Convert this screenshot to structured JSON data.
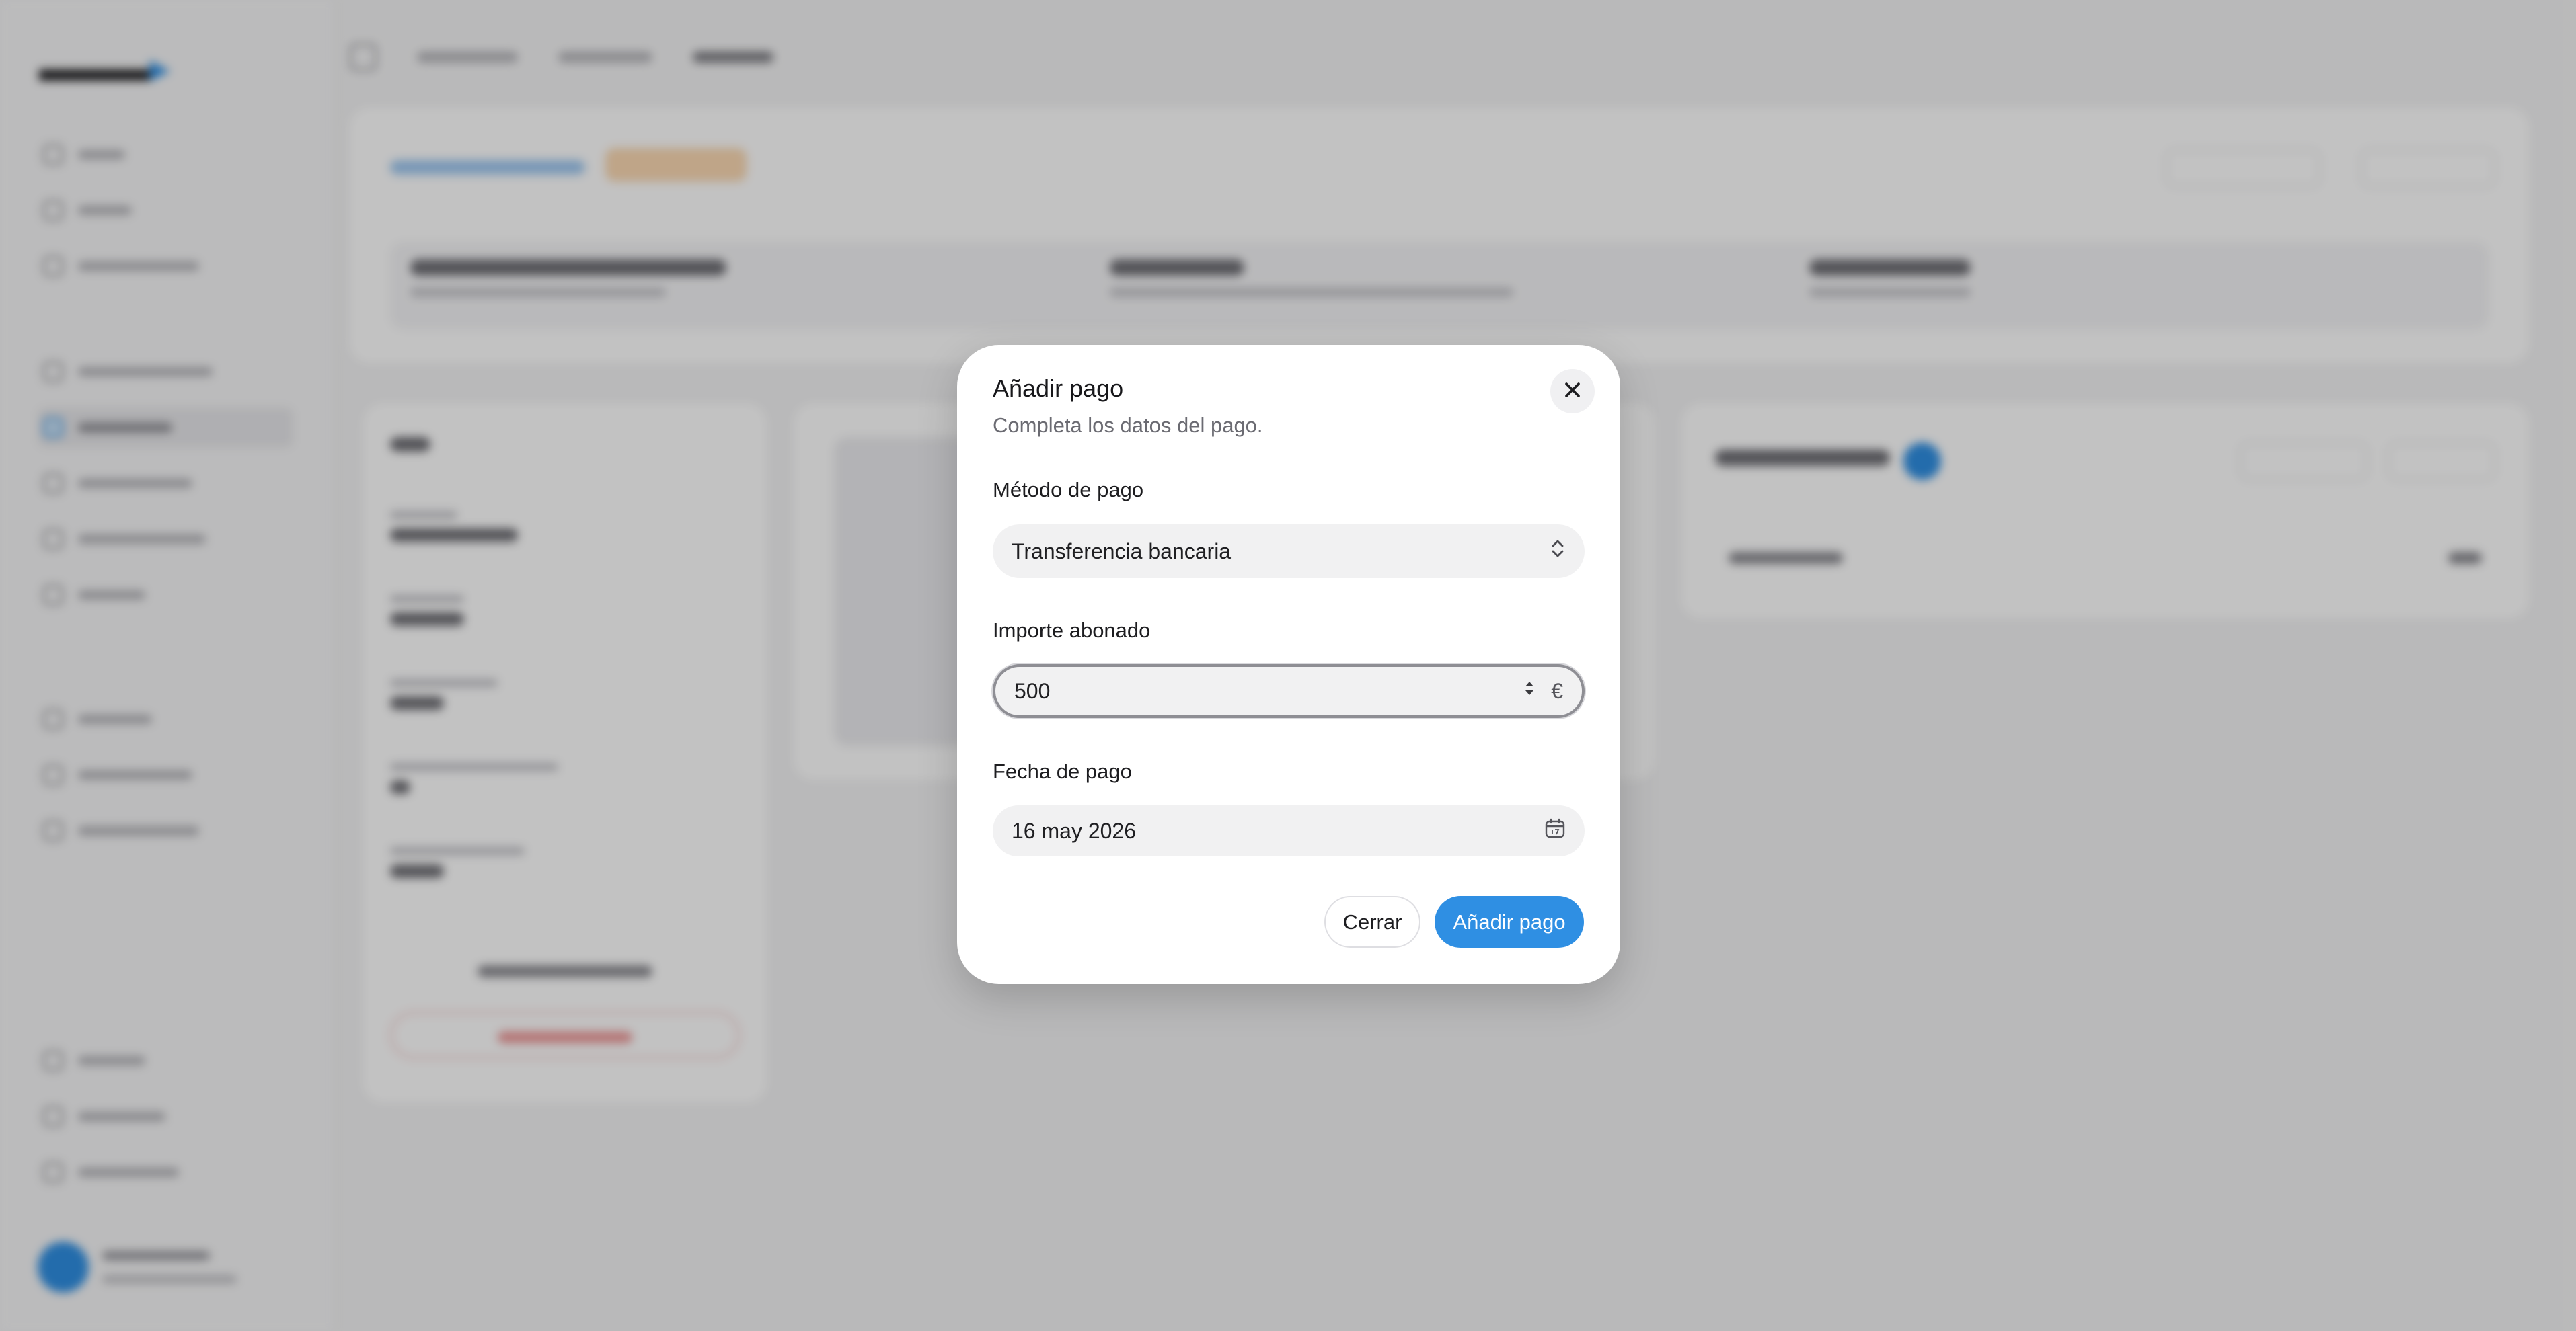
{
  "dialog": {
    "title": "Añadir pago",
    "subtitle": "Completa los datos del pago.",
    "payment_method": {
      "label": "Método de pago",
      "value": "Transferencia bancaria"
    },
    "amount": {
      "label": "Importe abonado",
      "value": "500",
      "currency": "€"
    },
    "payment_date": {
      "label": "Fecha de pago",
      "value": "16 may 2026"
    },
    "buttons": {
      "cancel": "Cerrar",
      "submit": "Añadir pago"
    }
  },
  "colors": {
    "accent": "#2f8fe3",
    "overlay": "rgba(0,0,0,0.24)"
  },
  "icons": {
    "close": "close-icon",
    "select": "chevron-updown-icon",
    "stepper": "stepper-arrows-icon",
    "calendar": "calendar-icon"
  }
}
